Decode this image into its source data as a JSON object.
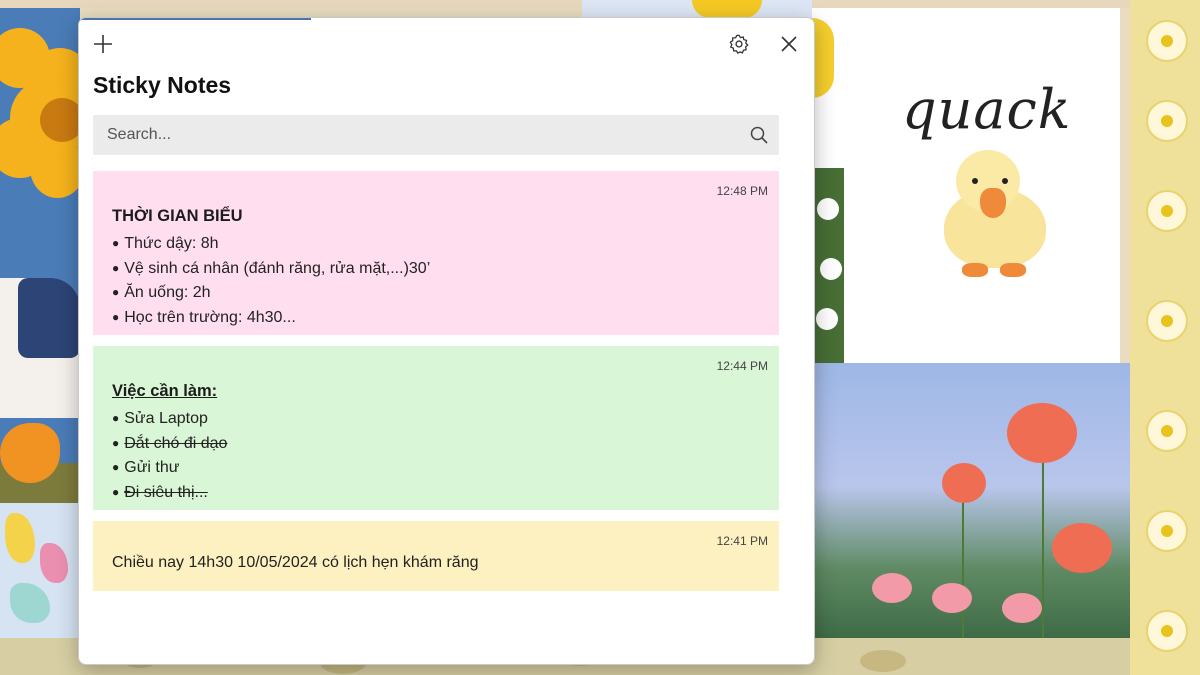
{
  "window": {
    "title": "Sticky Notes",
    "new_note_icon": "plus-icon",
    "settings_icon": "gear-icon",
    "close_icon": "close-icon"
  },
  "search": {
    "placeholder": "Search...",
    "value": "",
    "icon": "search-icon"
  },
  "notes": [
    {
      "color": "#ffdfef",
      "time": "12:48 PM",
      "heading": "THỜI GIAN BIỂU",
      "items": [
        {
          "text": "Thức dậy: 8h",
          "done": false
        },
        {
          "text": "Vệ sinh cá nhân (đánh răng, rửa mặt,...)30’",
          "done": false
        },
        {
          "text": "Ăn uống: 2h",
          "done": false
        },
        {
          "text": "Học trên trường: 4h30...",
          "done": false
        }
      ]
    },
    {
      "color": "#d9f6d6",
      "time": "12:44 PM",
      "heading": "Việc cần làm:",
      "items": [
        {
          "text": "Sửa Laptop",
          "done": false
        },
        {
          "text": "Dắt chó đi dạo",
          "done": true
        },
        {
          "text": "Gửi thư",
          "done": false
        },
        {
          "text": "Đi siêu thị...",
          "done": true
        }
      ]
    },
    {
      "color": "#fdf0c1",
      "time": "12:41 PM",
      "text": "Chiều nay 14h30 10/05/2024 có lịch hẹn khám răng"
    }
  ],
  "background": {
    "quack_text": "quack"
  },
  "colors": {
    "window_bg": "#ffffff",
    "search_bg": "#ebebeb",
    "accent": "#4f72a8"
  }
}
